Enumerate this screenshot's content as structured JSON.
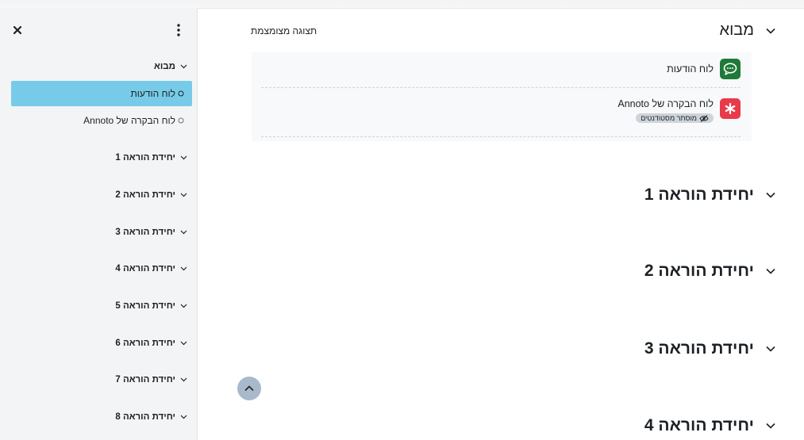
{
  "drawer": {
    "close_label": "×",
    "intro_section": "מבוא",
    "items": [
      {
        "label": "לוח הודעות",
        "active": true
      },
      {
        "label": "לוח הבקרה של Annoto",
        "active": false
      }
    ],
    "sections": [
      "יחידת הוראה 1",
      "יחידת הוראה 2",
      "יחידת הוראה 3",
      "יחידת הוראה 4",
      "יחידת הוראה 5",
      "יחידת הוראה 6",
      "יחידת הוראה 7",
      "יחידת הוראה 8"
    ]
  },
  "main": {
    "collapse_label": "תצוגה מצומצמת",
    "intro_title": "מבוא",
    "activities": [
      {
        "name": "לוח הודעות",
        "icon": "forum-icon",
        "color": "#1f7a3a"
      },
      {
        "name": "לוח הבקרה של Annoto",
        "icon": "annoto-asterisk-icon",
        "color": "#e83a4a",
        "badge": "מוסתר מסטודנטים"
      }
    ],
    "sections": [
      "יחידת הוראה 1",
      "יחידת הוראה 2",
      "יחידת הוראה 3",
      "יחידת הוראה 4"
    ]
  }
}
